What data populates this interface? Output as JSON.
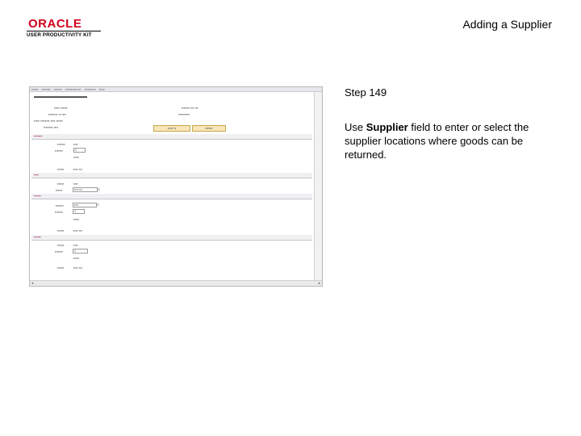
{
  "header": {
    "title": "Adding a Supplier",
    "logo_brand": "ORACLE",
    "logo_sub": "USER PRODUCTIVITY KIT"
  },
  "content": {
    "step": "Step 149",
    "instruction_prefix": "Use ",
    "instruction_bold": "Supplier",
    "instruction_suffix": " field to enter or select the supplier locations where goods can be returned."
  }
}
